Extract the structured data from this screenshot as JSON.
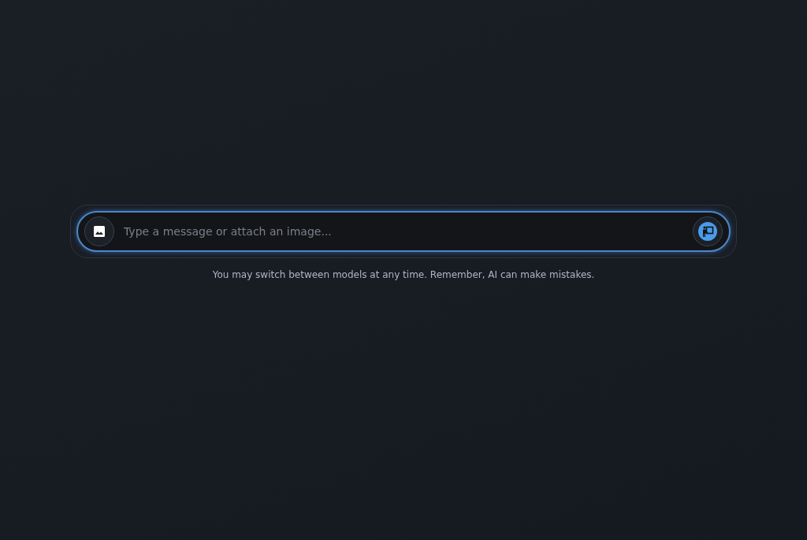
{
  "composer": {
    "placeholder": "Type a message or attach an image..."
  },
  "disclaimer": "You may switch between models at any time. Remember, AI can make mistakes."
}
